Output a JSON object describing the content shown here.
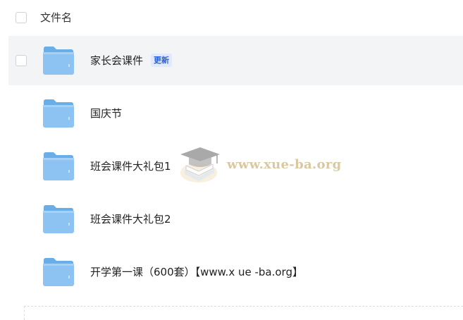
{
  "header": {
    "column_label": "文件名"
  },
  "files": [
    {
      "name": "家长会课件",
      "badge": "更新"
    },
    {
      "name": "国庆节"
    },
    {
      "name": "班会课件大礼包1"
    },
    {
      "name": "班会课件大礼包2"
    },
    {
      "name": "开学第一课（600套）【www.x ue -ba.org】"
    }
  ],
  "watermark": {
    "text": "www.xue-ba.org"
  },
  "colors": {
    "folder_body": "#8cc3f3",
    "folder_tab": "#6aaee8",
    "selected_row_bg": "#f3f4f6",
    "badge_bg": "#e0e9fd",
    "badge_text": "#2b5fd6"
  }
}
